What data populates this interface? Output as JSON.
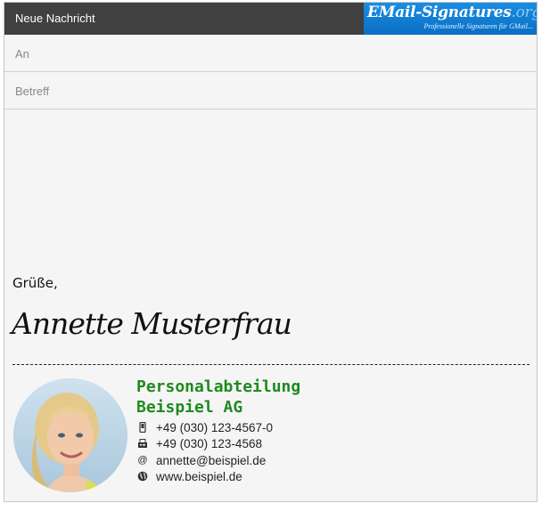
{
  "window": {
    "title": "Neue Nachricht",
    "logo_main": "EMail-Signatures",
    "logo_tld": ".org",
    "logo_tagline": "Professionelle Signaturen für GMail..."
  },
  "compose": {
    "to_placeholder": "An",
    "subject_placeholder": "Betreff"
  },
  "message": {
    "greeting": "Grüße,",
    "signature_name": "Annette Musterfrau"
  },
  "signature": {
    "department": "Personalabteilung",
    "company": "Beispiel AG",
    "accent_color": "#1f8a1f",
    "contacts": [
      {
        "icon": "mobile-phone-icon",
        "text": "+49 (030) 123-4567-0"
      },
      {
        "icon": "fax-icon",
        "text": "+49 (030) 123-4568"
      },
      {
        "icon": "at-sign-icon",
        "text": "annette@beispiel.de"
      },
      {
        "icon": "globe-icon",
        "text": "www.beispiel.de"
      }
    ]
  },
  "colors": {
    "titlebar": "#404040",
    "logo_blue": "#0a6fc4",
    "background": "#f5f5f5"
  }
}
